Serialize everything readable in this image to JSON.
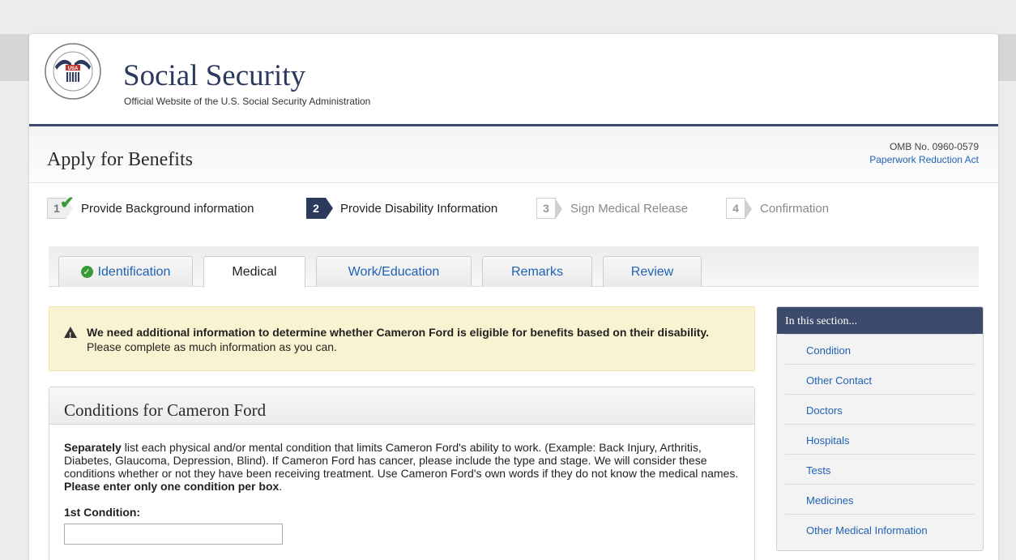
{
  "header": {
    "title": "Social Security",
    "subtitle": "Official Website of the U.S. Social Security Administration",
    "seal_text": "USA"
  },
  "app_bar": {
    "title": "Apply for Benefits",
    "omb": "OMB No. 0960-0579",
    "paperwork_link": "Paperwork Reduction Act"
  },
  "steps": [
    {
      "number": "1",
      "label": "Provide Background information",
      "state": "done"
    },
    {
      "number": "2",
      "label": "Provide Disability Information",
      "state": "current"
    },
    {
      "number": "3",
      "label": "Sign Medical Release",
      "state": "todo"
    },
    {
      "number": "4",
      "label": "Confirmation",
      "state": "todo"
    }
  ],
  "tabs": [
    {
      "label": "Identification",
      "state": "complete"
    },
    {
      "label": "Medical",
      "state": "active"
    },
    {
      "label": "Work/Education",
      "state": "inactive"
    },
    {
      "label": "Remarks",
      "state": "inactive"
    },
    {
      "label": "Review",
      "state": "inactive"
    }
  ],
  "alert": {
    "bold": "We need additional information to determine whether Cameron Ford is eligible for benefits based on their disability.",
    "text": " Please complete as much information as you can."
  },
  "panel": {
    "title": "Conditions for Cameron Ford",
    "intro_bold": "Separately",
    "intro_text": " list each physical and/or mental condition that limits Cameron Ford's ability to work. (Example: Back Injury, Arthritis, Diabetes, Glaucoma, Depression, Blind). If Cameron Ford has cancer, please include the type and stage. We will consider these conditions whether or not they have been receiving treatment. Use Cameron Ford's own words if they do not know the medical names. ",
    "intro_bold2": "Please enter only one condition per box",
    "intro_end": ".",
    "condition_label": "1st Condition:",
    "condition_value": ""
  },
  "side_nav": {
    "title": "In this section...",
    "items": [
      "Condition",
      "Other Contact",
      "Doctors",
      "Hospitals",
      "Tests",
      "Medicines",
      "Other Medical Information"
    ]
  },
  "colors": {
    "brand_navy": "#2b3a5c",
    "link_blue": "#1f62b5",
    "alert_bg": "#faf3d1",
    "success_green": "#3a9a3a"
  }
}
